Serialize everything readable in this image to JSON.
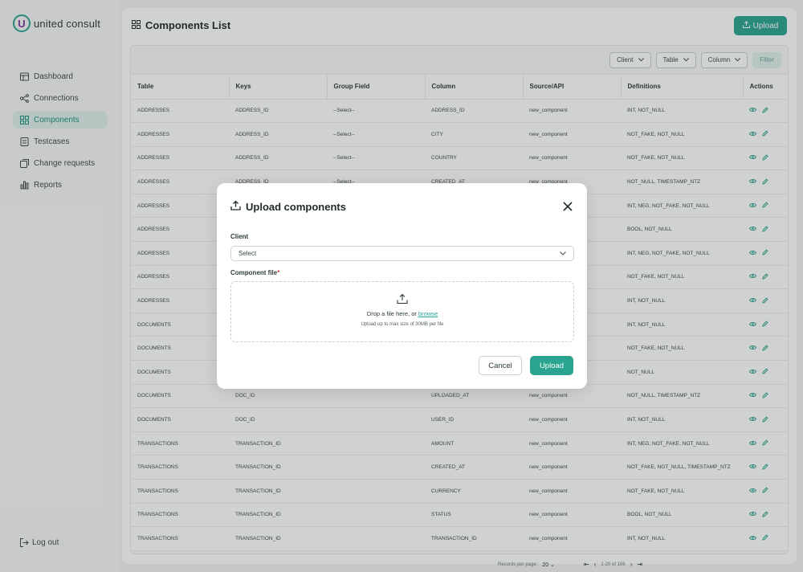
{
  "brand": {
    "logo_letter": "U",
    "name": "united consult"
  },
  "sidebar": {
    "items": [
      {
        "label": "Dashboard",
        "icon": "dashboard-icon"
      },
      {
        "label": "Connections",
        "icon": "connections-icon"
      },
      {
        "label": "Components",
        "icon": "components-icon",
        "active": true
      },
      {
        "label": "Testcases",
        "icon": "testcases-icon"
      },
      {
        "label": "Change requests",
        "icon": "change-requests-icon"
      },
      {
        "label": "Reports",
        "icon": "reports-icon"
      }
    ],
    "logout": "Log out"
  },
  "header": {
    "title": "Components List",
    "upload_label": "Upload"
  },
  "toolbar": {
    "client": "Client",
    "table": "Table",
    "column": "Column",
    "filter": "Filter"
  },
  "table": {
    "columns": [
      "Table",
      "Keys",
      "Group Field",
      "Column",
      "Source/API",
      "Definitions",
      "Actions"
    ],
    "rows": [
      [
        "ADDRESSES",
        "ADDRESS_ID",
        "--Select--",
        "ADDRESS_ID",
        "new_component",
        "INT, NOT_NULL"
      ],
      [
        "ADDRESSES",
        "ADDRESS_ID",
        "--Select--",
        "CITY",
        "new_component",
        "NOT_FAKE, NOT_NULL"
      ],
      [
        "ADDRESSES",
        "ADDRESS_ID",
        "--Select--",
        "COUNTRY",
        "new_component",
        "NOT_FAKE, NOT_NULL"
      ],
      [
        "ADDRESSES",
        "ADDRESS_ID",
        "--Select--",
        "CREATED_AT",
        "new_component",
        "NOT_NULL, TIMESTAMP_NTZ"
      ],
      [
        "ADDRESSES",
        "",
        "",
        "",
        "",
        "INT, NEG, NOT_FAKE, NOT_NULL"
      ],
      [
        "ADDRESSES",
        "",
        "",
        "",
        "",
        "BOOL, NOT_NULL"
      ],
      [
        "ADDRESSES",
        "",
        "",
        "",
        "",
        "INT, NEG, NOT_FAKE, NOT_NULL"
      ],
      [
        "ADDRESSES",
        "",
        "",
        "",
        "",
        "NOT_FAKE, NOT_NULL"
      ],
      [
        "ADDRESSES",
        "",
        "",
        "",
        "",
        "INT, NOT_NULL"
      ],
      [
        "DOCUMENTS",
        "",
        "",
        "",
        "",
        "INT, NOT_NULL"
      ],
      [
        "DOCUMENTS",
        "",
        "",
        "",
        "",
        "NOT_FAKE, NOT_NULL"
      ],
      [
        "DOCUMENTS",
        "",
        "",
        "",
        "",
        "NOT_NULL"
      ],
      [
        "DOCUMENTS",
        "DOC_ID",
        "",
        "UPLOADED_AT",
        "new_component",
        "NOT_NULL, TIMESTAMP_NTZ"
      ],
      [
        "DOCUMENTS",
        "DOC_ID",
        "",
        "USER_ID",
        "new_component",
        "INT, NOT_NULL"
      ],
      [
        "TRANSACTIONS",
        "TRANSACTION_ID",
        "",
        "AMOUNT",
        "new_component",
        "INT, NEG, NOT_FAKE, NOT_NULL"
      ],
      [
        "TRANSACTIONS",
        "TRANSACTION_ID",
        "",
        "CREATED_AT",
        "new_component",
        "NOT_FAKE, NOT_NULL, TIMESTAMP_NTZ"
      ],
      [
        "TRANSACTIONS",
        "TRANSACTION_ID",
        "",
        "CURRENCY",
        "new_component",
        "NOT_FAKE, NOT_NULL"
      ],
      [
        "TRANSACTIONS",
        "TRANSACTION_ID",
        "",
        "STATUS",
        "new_component",
        "BOOL, NOT_NULL"
      ],
      [
        "TRANSACTIONS",
        "TRANSACTION_ID",
        "",
        "TRANSACTION_ID",
        "new_component",
        "INT, NOT_NULL"
      ]
    ]
  },
  "pager": {
    "records_label": "Records per page:",
    "per_page": "20",
    "range": "1-20 of 106"
  },
  "modal": {
    "title": "Upload components",
    "client_label": "Client",
    "client_value": "Select",
    "file_label": "Component file",
    "required_mark": "*",
    "drop_text": "Drop a file here, or",
    "browse": "browse",
    "limit_text": "Upload up to max size of 30MB per file",
    "cancel": "Cancel",
    "upload": "Upload"
  },
  "colors": {
    "accent": "#2aa48f",
    "active_bg": "#dff1ec"
  }
}
